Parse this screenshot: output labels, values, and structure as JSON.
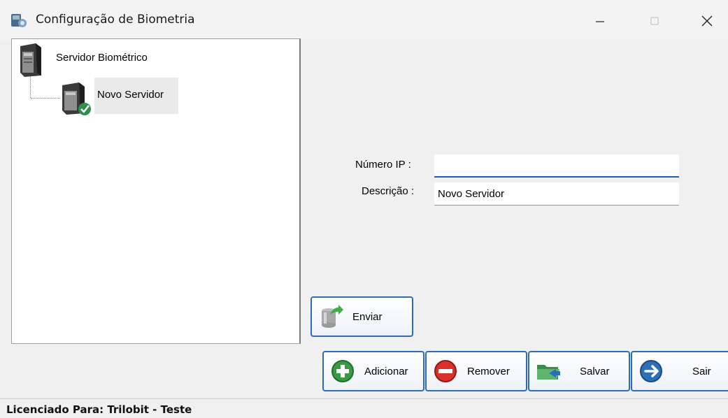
{
  "window": {
    "title": "Configuração de Biometria",
    "app_icon": "biometry-app-icon",
    "controls": {
      "minimize": "minimize-icon",
      "maximize": "maximize-icon",
      "close": "close-icon"
    }
  },
  "tree": {
    "root": {
      "label": "Servidor Biométrico",
      "icon": "server-icon"
    },
    "children": [
      {
        "label": "Novo Servidor",
        "icon": "server-connected-icon",
        "selected": true
      }
    ]
  },
  "form": {
    "ip_label": "Número IP :",
    "ip_value": "",
    "desc_label": "Descrição :",
    "desc_value": "Novo Servidor"
  },
  "buttons": {
    "enviar": "Enviar",
    "adicionar": "Adicionar",
    "remover": "Remover",
    "salvar": "Salvar",
    "sair": "Sair"
  },
  "status": {
    "text": "Licenciado Para: Trilobit - Teste"
  },
  "colors": {
    "accent": "#2d6cb5",
    "focus_underline": "#1a5fb4",
    "window_bg": "#f0f0f0"
  }
}
